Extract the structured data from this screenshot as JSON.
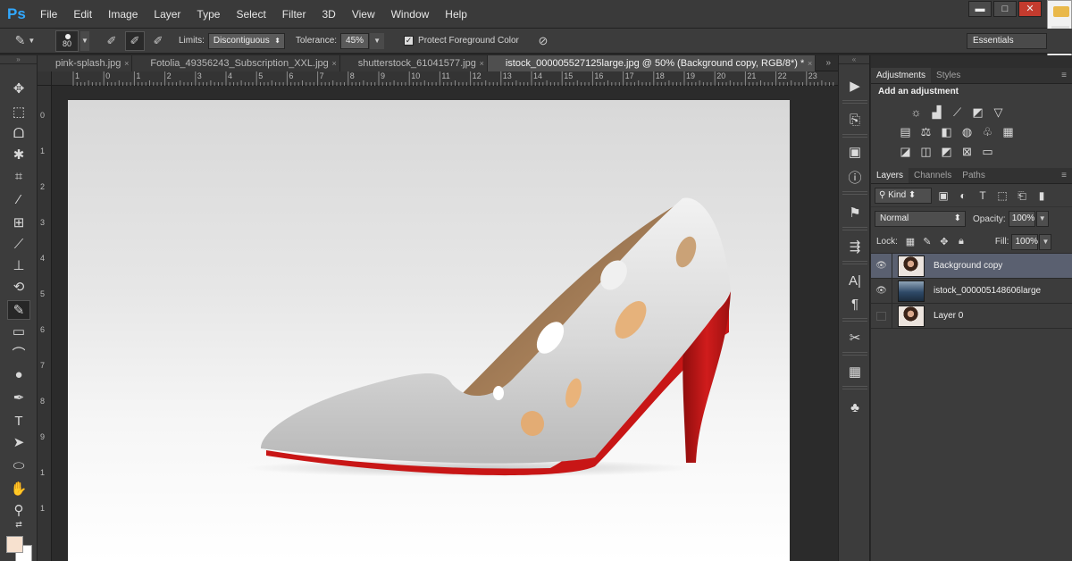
{
  "app": {
    "logo": "Ps"
  },
  "menu": [
    "File",
    "Edit",
    "Image",
    "Layer",
    "Type",
    "Select",
    "Filter",
    "3D",
    "View",
    "Window",
    "Help"
  ],
  "window_controls": {
    "minimize": "▬",
    "maximize": "□",
    "close": "✕"
  },
  "options_bar": {
    "brush_size": "80",
    "limits_label": "Limits:",
    "limits_value": "Discontiguous",
    "tolerance_label": "Tolerance:",
    "tolerance_value": "45%",
    "protect_label": "Protect Foreground Color",
    "protect_checked": true,
    "workspace": "Essentials"
  },
  "doc_tabs": [
    {
      "label": "pink-splash.jpg",
      "active": false
    },
    {
      "label": "Fotolia_49356243_Subscription_XXL.jpg",
      "active": false
    },
    {
      "label": "shutterstock_61041577.jpg",
      "active": false
    },
    {
      "label": "istock_000005527125large.jpg @ 50% (Background copy, RGB/8*) *",
      "active": true
    }
  ],
  "ruler": {
    "top": [
      "1",
      "0",
      "1",
      "2",
      "3",
      "4",
      "5",
      "6",
      "7",
      "8",
      "9",
      "10",
      "11",
      "12",
      "13",
      "14",
      "15",
      "16",
      "17",
      "18",
      "19",
      "20",
      "21",
      "22",
      "23"
    ],
    "left": [
      "0",
      "1",
      "2",
      "3",
      "4",
      "5",
      "6",
      "7",
      "8",
      "9",
      "1",
      "1"
    ]
  },
  "colors": {
    "foreground": "#f7e1cf",
    "background": "#ffffff",
    "heel_red": "#d01c1c",
    "accent_blue": "#31a8ff"
  },
  "adjustments_panel": {
    "tabs": [
      "Adjustments",
      "Styles"
    ],
    "title": "Add an adjustment",
    "icons_row1": [
      "brightness-contrast",
      "levels",
      "curves",
      "exposure",
      "vibrance"
    ],
    "icons_row2": [
      "hue-saturation",
      "color-balance",
      "black-white",
      "photo-filter",
      "channel-mixer",
      "color-lookup"
    ],
    "icons_row3": [
      "invert",
      "posterize",
      "threshold",
      "selective-color",
      "gradient-map"
    ]
  },
  "layers_panel": {
    "tabs": [
      "Layers",
      "Channels",
      "Paths"
    ],
    "filter_kind": "Kind",
    "blend_mode": "Normal",
    "opacity_label": "Opacity:",
    "opacity_value": "100%",
    "lock_label": "Lock:",
    "fill_label": "Fill:",
    "fill_value": "100%",
    "layers": [
      {
        "name": "Background copy",
        "visible": true,
        "selected": true,
        "thumb": "portrait"
      },
      {
        "name": "istock_000005148606large",
        "visible": true,
        "selected": false,
        "thumb": "photo"
      },
      {
        "name": "Layer 0",
        "visible": false,
        "selected": false,
        "thumb": "portrait"
      }
    ]
  },
  "tools": [
    "move",
    "marquee",
    "lasso",
    "quick-selection",
    "crop",
    "eyedropper",
    "healing-brush",
    "brush",
    "clone-stamp",
    "history-brush",
    "color-replacement",
    "gradient",
    "blur",
    "dodge",
    "pen",
    "type",
    "path-selection",
    "ellipse",
    "hand",
    "zoom"
  ],
  "active_tool": "color-replacement"
}
